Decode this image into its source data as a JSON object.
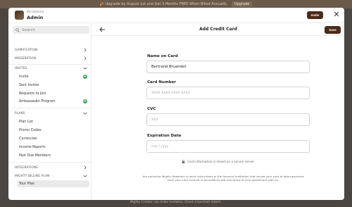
{
  "banner": {
    "text": "🎉 Upgrade by August 1st and Get 3 Months FREE When Billed Annually.",
    "cta": "Upgrade"
  },
  "header": {
    "app_name": "Mindsplore",
    "role": "Admin",
    "invite_label": "Invite"
  },
  "search": {
    "placeholder": "Search"
  },
  "sidebar": {
    "sections": [
      {
        "label": "GAMIFICATION",
        "state": "collapsed"
      },
      {
        "label": "MODERATION",
        "state": "collapsed"
      },
      {
        "label": "INVITES",
        "state": "expanded",
        "items": [
          "Invite",
          "Sent Invites",
          "Requests to Join",
          "Ambassador Program"
        ]
      },
      {
        "label": "PLANS",
        "state": "expanded",
        "items": [
          "Plan List",
          "Promo Codes",
          "Currencies",
          "Income Reports",
          "Past Due Members"
        ]
      },
      {
        "label": "INTEGRATIONS",
        "state": "collapsed"
      },
      {
        "label": "MIGHTY BILLING PLAN",
        "state": "expanded",
        "items": [
          "Your Plan"
        ]
      }
    ],
    "active_item": "Your Plan"
  },
  "main": {
    "title": "Add Credit Card",
    "save_label": "Save",
    "fields": {
      "name": {
        "label": "Name on Card",
        "value": "Bertrand Bruandet"
      },
      "card": {
        "label": "Card Number",
        "placeholder": "XXXX XXXX XXXX XXXX"
      },
      "cvc": {
        "label": "CVC",
        "placeholder": "XXX"
      },
      "exp": {
        "label": "Expiration Date",
        "placeholder": "mm / yyyy"
      }
    },
    "secure_note": "Card information is stored on a secure server.",
    "authorization": "You authorize Mighty Networks to send instructions to the financial institution that issued your card to take payments from your card account in accordance with the terms of your agreement with us."
  },
  "footer_note": "Mighty Creator can make mistakes. Check important details.",
  "colors": {
    "accent": "#4b2a1a",
    "plus": "#3da55b",
    "backdrop": "#4c4641"
  },
  "icons": [
    "search-icon",
    "chevron-right-icon",
    "chevron-down-icon",
    "plus-icon",
    "back-arrow-icon",
    "close-icon",
    "lock-icon"
  ]
}
